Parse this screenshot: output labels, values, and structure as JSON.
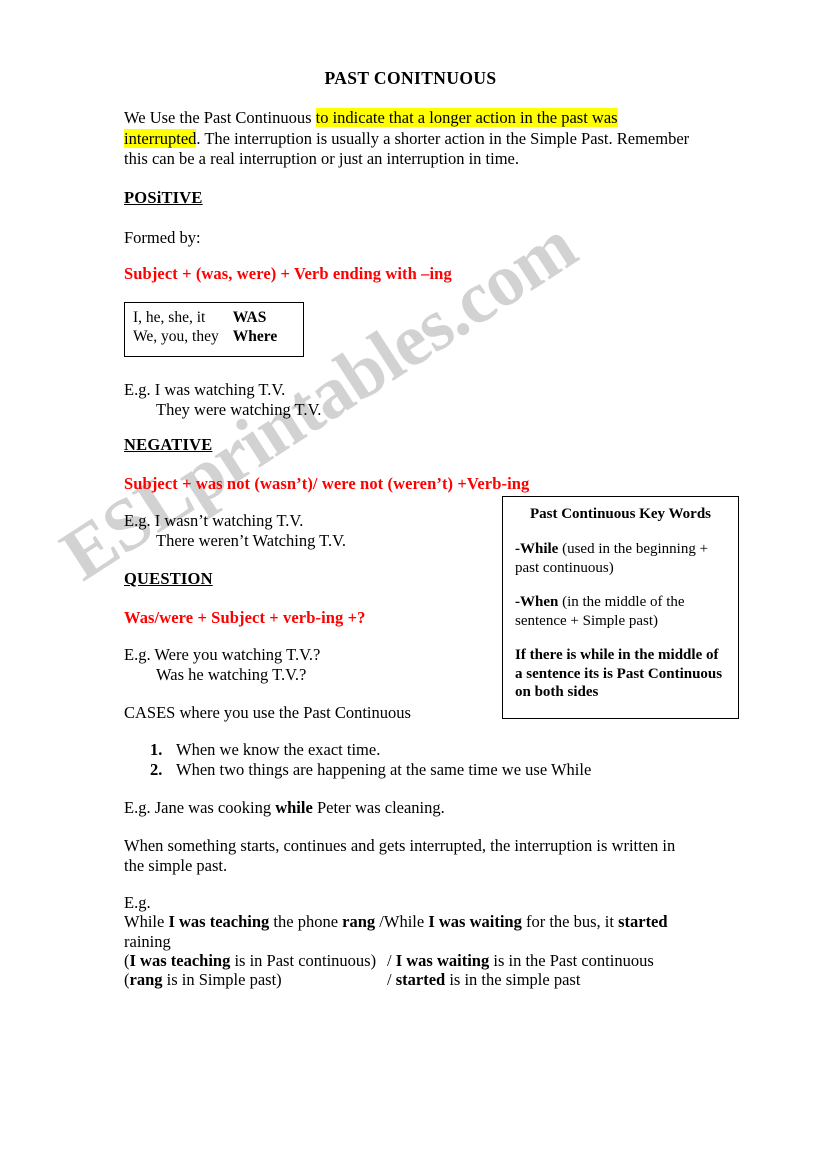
{
  "document": {
    "title": "PAST CONITNUOUS",
    "watermark": "ESLprintables.com",
    "intro": {
      "lead": "We Use the Past Continuous ",
      "highlight": "to indicate that a longer action in the past was interrupted",
      "rest": ". The interruption is usually a shorter action in the Simple Past. Remember this can be a real interruption or just an interruption in time."
    },
    "positive": {
      "heading": "POSiTIVE",
      "formed_by": "Formed by:",
      "formula": "Subject + (was, were) + Verb ending with –ing",
      "aux_table": {
        "rows": [
          {
            "pronouns": "I, he, she, it",
            "aux": "WAS"
          },
          {
            "pronouns": "We, you, they",
            "aux": "Where"
          }
        ]
      },
      "examples": [
        "E.g. I was watching T.V.",
        "They were watching T.V."
      ]
    },
    "negative": {
      "heading": "NEGATIVE",
      "formula": "Subject + was not (wasn’t)/ were not (weren’t) +Verb-ing",
      "examples": [
        "E.g. I wasn’t watching T.V.",
        "There weren’t Watching T.V."
      ]
    },
    "question": {
      "heading": "QUESTION",
      "formula": "Was/were  + Subject  + verb-ing +?",
      "examples": [
        "E.g. Were you watching T.V.?",
        "Was he watching T.V.?"
      ]
    },
    "cases": {
      "intro": "CASES where you use the Past Continuous",
      "items": [
        {
          "num": "1.",
          "text": "When we know the exact time."
        },
        {
          "num": "2.",
          "text": "When two things are happening at the same time we use While"
        }
      ],
      "example_pre": "E.g. Jane was cooking ",
      "example_bold": "while",
      "example_post": " Peter was cleaning.",
      "note": "When something starts, continues and gets interrupted, the interruption is written in the simple past."
    },
    "final": {
      "eg_label": "E.g.",
      "sentence": {
        "p1": "While ",
        "b1": "I was teaching",
        "p2": " the phone ",
        "b2": "rang",
        "p3": " /While ",
        "b3": "I was waiting",
        "p4": " for the bus, it ",
        "b4": "started",
        "p5": "raining"
      },
      "explanations": [
        {
          "left_open": "(",
          "left_bold": "I was teaching",
          "left_rest": " is in Past continuous)",
          "right_slash": "/ ",
          "right_bold": "I was waiting",
          "right_rest": " is in the Past continuous"
        },
        {
          "left_open": "(",
          "left_bold": "rang",
          "left_rest": " is in Simple past)",
          "right_slash": "/ ",
          "right_bold": "started",
          "right_rest": " is in the simple past"
        }
      ]
    },
    "keywords_box": {
      "title": "Past Continuous Key Words",
      "entries": [
        {
          "dash": "-",
          "word": "While",
          "rest": " (used in the beginning + past continuous)"
        },
        {
          "dash": "-",
          "word": "When",
          "rest": " (in the middle of the sentence + Simple past)"
        }
      ],
      "note": "If there is while in the middle of a sentence its is Past Continuous on both sides"
    },
    "colors": {
      "highlight": "#ffff00",
      "formula": "#ff0000",
      "text": "#000000",
      "watermark": "#d2d2d2",
      "page": "#ffffff"
    }
  }
}
